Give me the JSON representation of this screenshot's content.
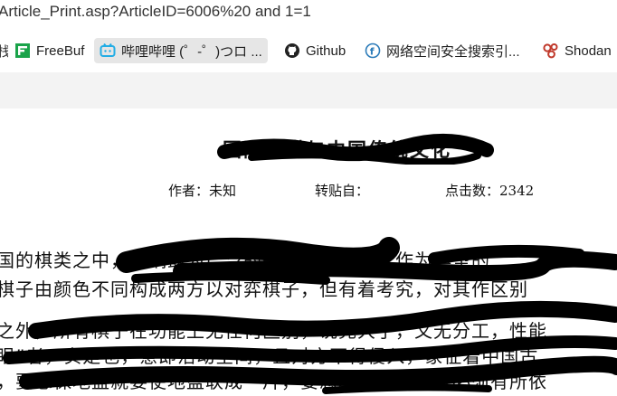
{
  "browser": {
    "url": "Article_Print.asp?ArticleID=6006%20 and 1=1"
  },
  "bookmarks": [
    {
      "label": "FreeBuf",
      "icon": "freebuf-icon"
    },
    {
      "label": "哔哩哔哩 (゜-゜)つロ ...",
      "icon": "bilibili-icon"
    },
    {
      "label": "Github",
      "icon": "github-icon"
    },
    {
      "label": "网络空间安全搜索引...",
      "icon": "fofa-icon"
    },
    {
      "label": "Shodan",
      "icon": "shodan-icon"
    }
  ],
  "article": {
    "title": "国际象棋与中国传统文化",
    "author_label": "作者：未知",
    "source_label": "转贴自：",
    "clicks_label": "点击数：2342",
    "lines": [
      "国的棋类之中，影响最为广泛的是围棋和象棋，作为典型的",
      "棋子由颜色不同构成两方以对弈棋子，但有着考究，对其作区别",
      "之外，所有棋子在功能上无任何区别，说完大了，又无分工，性能",
      "眼”者，实是也，意即活动空间，且对方不得侵入，象征着中国古",
      "，要想保地盘就要使地盘联成一片，要想地盘不大，就必须有所依"
    ]
  },
  "colors": {
    "band": "#f3f3f3",
    "active_tab": "#e6e6e6",
    "freebuf": "#1aa34a",
    "bilibili": "#23ade5",
    "fofa": "#2b7bb9",
    "shodan": "#c0392b"
  }
}
